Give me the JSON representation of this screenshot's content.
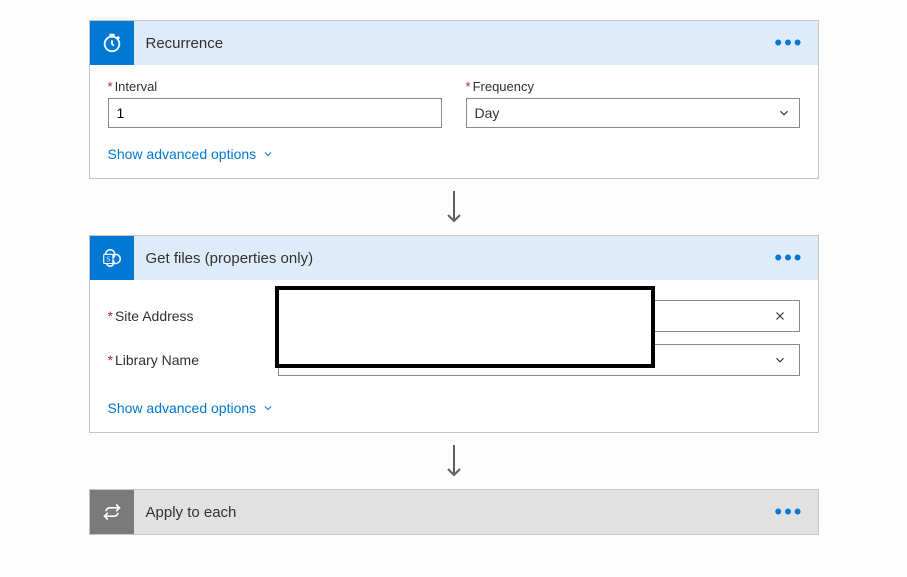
{
  "card1": {
    "title": "Recurrence",
    "intervalLabel": "Interval",
    "intervalValue": "1",
    "frequencyLabel": "Frequency",
    "frequencyValue": "Day",
    "advanced": "Show advanced options"
  },
  "card2": {
    "title": "Get files (properties only)",
    "siteLabel": "Site Address",
    "siteValue": "",
    "libraryLabel": "Library Name",
    "libraryValue": "",
    "advanced": "Show advanced options"
  },
  "card3": {
    "title": "Apply to each"
  }
}
